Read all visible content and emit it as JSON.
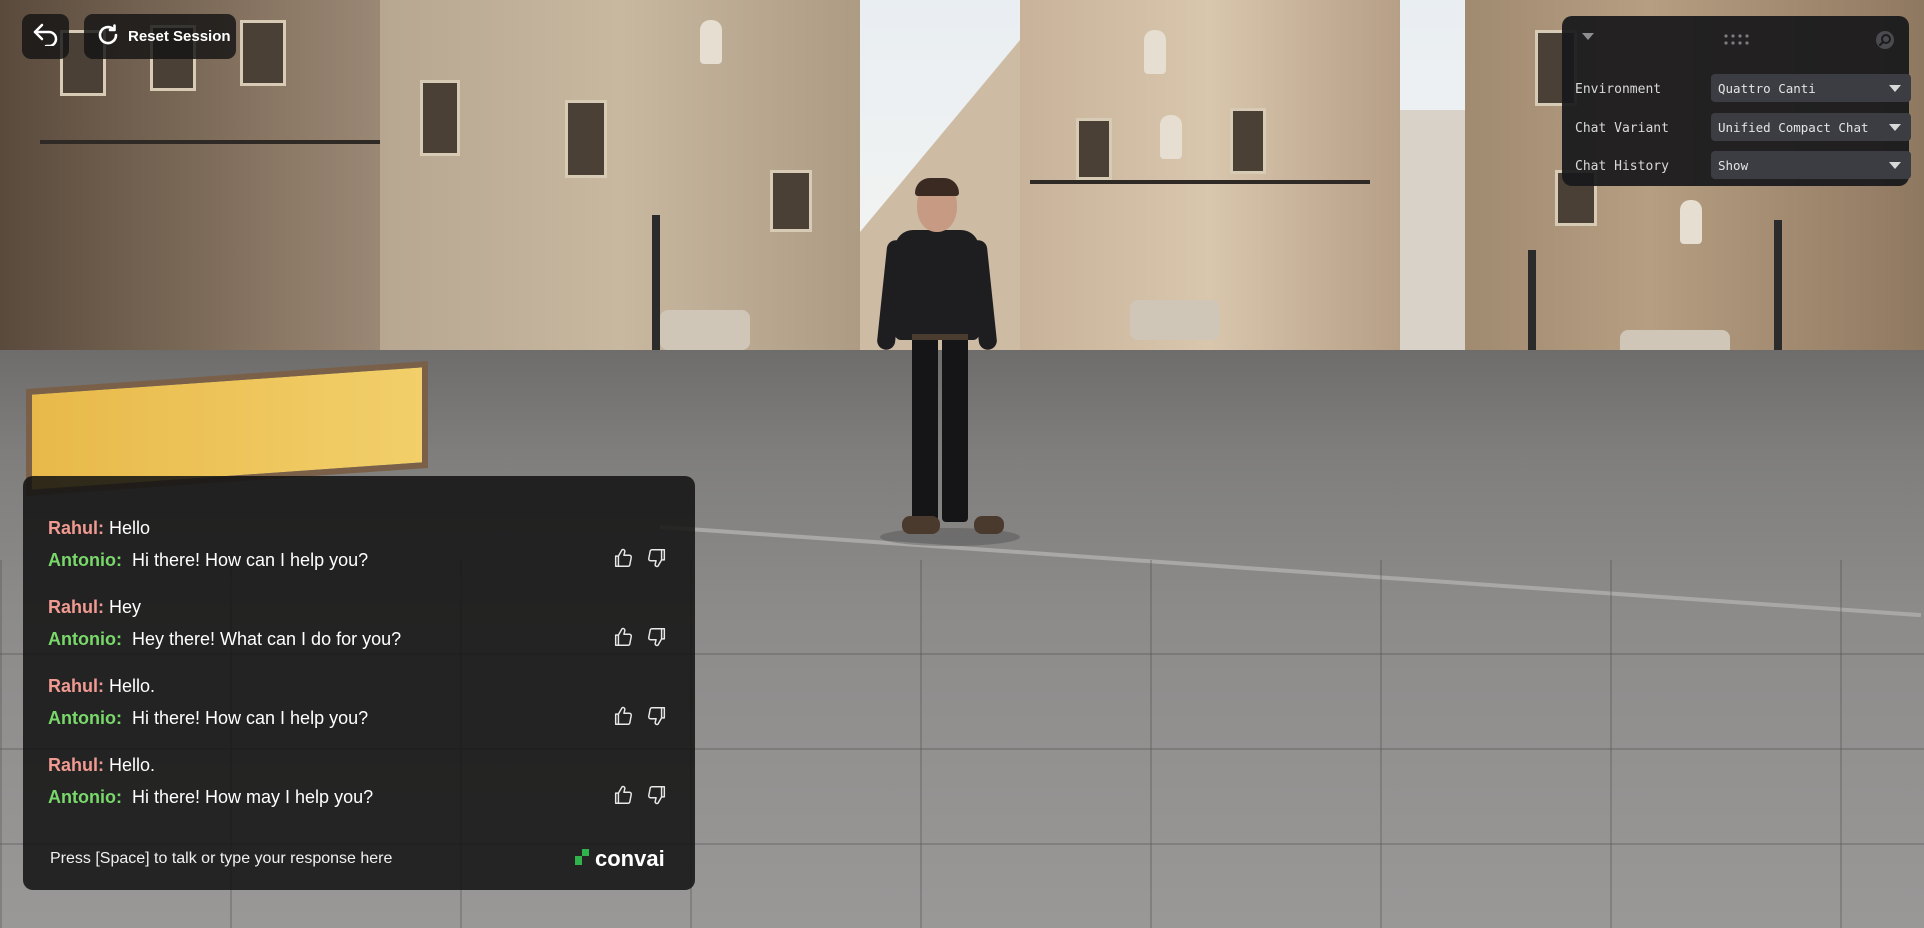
{
  "controls": {
    "back_icon": "back-arrow-icon",
    "reset_label": "Reset Session",
    "reset_icon": "refresh-icon"
  },
  "settings_panel": {
    "icons": [
      "collapse-chevron-icon",
      "drag-handle-icon",
      "search-icon"
    ],
    "rows": [
      {
        "label": "Environment",
        "value": "Quattro Canti"
      },
      {
        "label": "Chat Variant",
        "value": "Unified Compact Chat"
      },
      {
        "label": "Chat History",
        "value": "Show"
      }
    ]
  },
  "chat": {
    "messages": [
      {
        "speaker": "Rahul:",
        "text": "Hello"
      },
      {
        "speaker": "Antonio:",
        "text": "Hi there! How can I help you?"
      },
      {
        "speaker": "Rahul:",
        "text": "Hey"
      },
      {
        "speaker": "Antonio:",
        "text": "Hey there! What can I do for you?"
      },
      {
        "speaker": "Rahul:",
        "text": "Hello."
      },
      {
        "speaker": "Antonio:",
        "text": "Hi there! How can I help you?"
      },
      {
        "speaker": "Rahul:",
        "text": "Hello."
      },
      {
        "speaker": "Antonio:",
        "text": "Hi there! How may I help you?"
      }
    ],
    "input_prompt": "Press [Space] to talk or type your response here",
    "brand": "convai",
    "feedback_icons": [
      "thumbs-up-icon",
      "thumbs-down-icon"
    ]
  },
  "colors": {
    "user_name": "#f09a92",
    "bot_name": "#79d86a",
    "panel_bg": "#18181a",
    "brand_accent": "#2fb34a"
  }
}
